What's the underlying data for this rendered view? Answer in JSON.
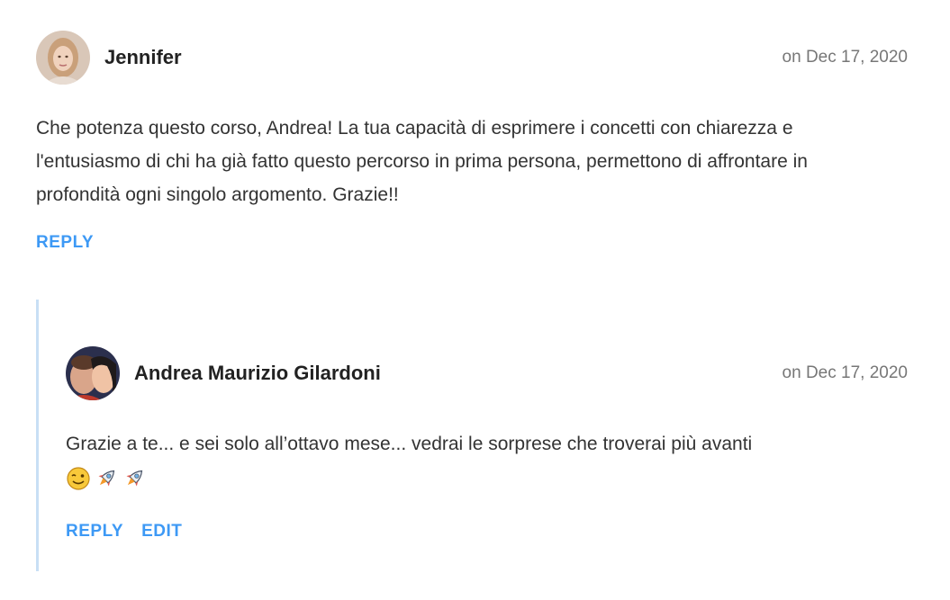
{
  "comments": [
    {
      "author": "Jennifer",
      "date": "on Dec 17, 2020",
      "text": "Che potenza questo corso, Andrea! La tua capacità di esprimere i concetti con chiarezza e l'entusiasmo di chi ha già fatto questo percorso in prima persona, permettono di affrontare in profondità ogni singolo argomento. Grazie!!",
      "actions": [
        "REPLY"
      ]
    },
    {
      "author": "Andrea Maurizio Gilardoni",
      "date": "on Dec 17, 2020",
      "text": "Grazie a te... e sei solo all’ottavo mese... vedrai le sorprese che troverai più avanti",
      "emojis": [
        "winking-face-icon",
        "rocket-icon",
        "rocket-icon"
      ],
      "actions": [
        "REPLY",
        "EDIT"
      ]
    }
  ],
  "colors": {
    "action": "#3d99f5",
    "thread_line": "#c8dff5",
    "date": "#777777"
  }
}
